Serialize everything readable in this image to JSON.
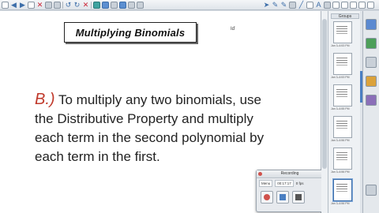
{
  "toolbar": {
    "icons": [
      "new-page-icon",
      "back-arrow-icon",
      "forward-arrow-icon",
      "add-page-icon",
      "delete-page-icon",
      "screen-shade-icon",
      "table-icon",
      "display-icon",
      "capture-icon",
      "undo-icon",
      "redo-icon",
      "delete-icon",
      "pen-icon",
      "highlighter-icon",
      "shape-icon",
      "eraser-icon",
      "line-icon",
      "text-icon",
      "fill-icon",
      "properties-icon"
    ]
  },
  "slide": {
    "title": "Multiplying Binomials",
    "cursor_marker": "Iď",
    "step_letter": "B.)",
    "body_text": "To multiply any two binomials, use the Distributive Property and multiply each term in the second polynomial by each term in the first."
  },
  "recording": {
    "title": "Recording",
    "menu_label": "Menu",
    "timer": "00:17:17",
    "fps": "0 fps"
  },
  "sidebar": {
    "header": "Groups",
    "thumb_labels": [
      "Jan 3–6:53 PM",
      "Jan 3–6:53 PM",
      "Jan 3–6:55 PM",
      "Jan 3–6:56 PM",
      "Jan 3–6:56 PM",
      "Jan 3–6:56 PM"
    ]
  },
  "tabs": [
    "page-sorter-tab",
    "gallery-tab",
    "attachments-tab",
    "properties-tab",
    "addons-tab",
    "settings-tab"
  ]
}
